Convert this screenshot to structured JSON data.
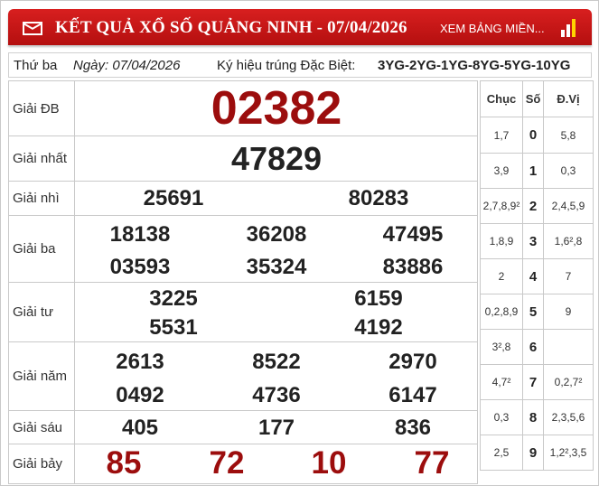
{
  "header": {
    "title": "KẾT QUẢ XỔ SỐ QUẢNG NINH - 07/04/2026",
    "link": "XEM BẢNG MIỀN..."
  },
  "info": {
    "weekday": "Thứ ba",
    "date": "Ngày: 07/04/2026",
    "code_label": "Ký hiệu trúng Đặc Biệt:",
    "code_value": "3YG-2YG-1YG-8YG-5YG-10YG"
  },
  "prizes": {
    "db": {
      "label": "Giải ĐB",
      "values": [
        "02382"
      ]
    },
    "g1": {
      "label": "Giải nhất",
      "values": [
        "47829"
      ]
    },
    "g2": {
      "label": "Giải nhì",
      "values": [
        "25691",
        "80283"
      ]
    },
    "g3": {
      "label": "Giải ba",
      "values": [
        "18138",
        "36208",
        "47495",
        "03593",
        "35324",
        "83886"
      ]
    },
    "g4": {
      "label": "Giải tư",
      "values": [
        "3225",
        "6159",
        "5531",
        "4192"
      ]
    },
    "g5": {
      "label": "Giải năm",
      "values": [
        "2613",
        "8522",
        "2970",
        "0492",
        "4736",
        "6147"
      ]
    },
    "g6": {
      "label": "Giải sáu",
      "values": [
        "405",
        "177",
        "836"
      ]
    },
    "g7": {
      "label": "Giải bảy",
      "values": [
        "85",
        "72",
        "10",
        "77"
      ]
    }
  },
  "loto": {
    "headers": [
      "Chục",
      "Số",
      "Đ.Vị"
    ],
    "rows": [
      {
        "chuc": "1,7",
        "so": "0",
        "dv": "5,8"
      },
      {
        "chuc": "3,9",
        "so": "1",
        "dv": "0,3"
      },
      {
        "chuc": "2,7,8,9²",
        "so": "2",
        "dv": "2,4,5,9"
      },
      {
        "chuc": "1,8,9",
        "so": "3",
        "dv": "1,6²,8"
      },
      {
        "chuc": "2",
        "so": "4",
        "dv": "7"
      },
      {
        "chuc": "0,2,8,9",
        "so": "5",
        "dv": "9"
      },
      {
        "chuc": "3²,8",
        "so": "6",
        "dv": ""
      },
      {
        "chuc": "4,7²",
        "so": "7",
        "dv": "0,2,7²"
      },
      {
        "chuc": "0,3",
        "so": "8",
        "dv": "2,3,5,6"
      },
      {
        "chuc": "2,5",
        "so": "9",
        "dv": "1,2²,3,5"
      }
    ]
  }
}
